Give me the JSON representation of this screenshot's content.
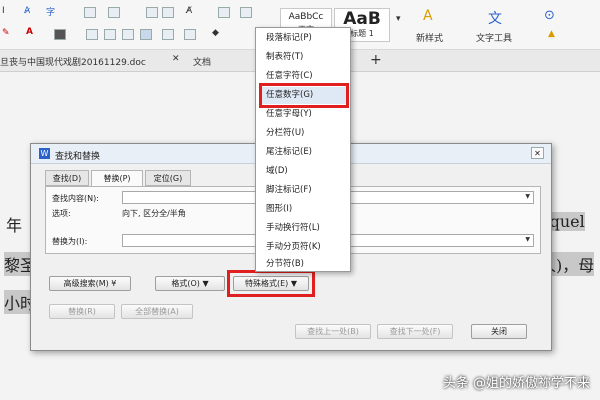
{
  "ribbon": {
    "style_samples": [
      {
        "sample": "AaBbCc",
        "label": "正文"
      },
      {
        "sample": "AaB",
        "label": "标题 1"
      }
    ],
    "new_style_label": "新样式",
    "text_tools_label": "文字工具",
    "font_a_label": "A"
  },
  "tabs": {
    "doc1_name": "旦丧与中国现代戏剧20161129.doc",
    "doc2_name": "文档",
    "new_tab": "+"
  },
  "document": {
    "line1_left": "年",
    "line1_right": "oquel",
    "line2_left": "黎圣",
    "line2_right": "人)，母",
    "line3_left": "小时"
  },
  "dialog": {
    "title": "查找和替换",
    "tabs": [
      "查找(D)",
      "替换(P)",
      "定位(G)"
    ],
    "active_tab": 1,
    "find_label": "查找内容(N):",
    "find_value": "",
    "options_label": "选项:",
    "options_value": "向下, 区分全/半角",
    "replace_label": "替换为(I):",
    "replace_value": "",
    "advanced_search": "高级搜索(M)",
    "format_button": "格式(O)",
    "special_format_button": "特殊格式(E)",
    "replace_button": "替换(R)",
    "replace_all_button": "全部替换(A)",
    "find_prev_button": "查找上一处(B)",
    "find_next_button": "查找下一处(F)",
    "close_button": "关闭"
  },
  "special_menu": {
    "items": [
      "段落标记(P)",
      "制表符(T)",
      "任意字符(C)",
      "任意数字(G)",
      "任意字母(Y)",
      "分栏符(U)",
      "尾注标记(E)",
      "域(D)",
      "脚注标记(F)",
      "图形(I)",
      "手动换行符(L)",
      "手动分页符(K)",
      "分节符(B)"
    ],
    "selected_index": 3
  },
  "watermark": "头条 @姐的娇傲祢学不来",
  "colors": {
    "highlight_box": "#e02020",
    "menu_selected": "#dfe9f6",
    "dialog_title_bg": "#e9eff6"
  }
}
